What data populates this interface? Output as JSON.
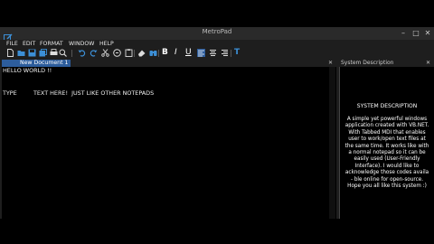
{
  "window": {
    "title": "MetroPad",
    "minimize": "–",
    "maximize": "□",
    "close": "✕"
  },
  "menu": [
    "FILE",
    "EDIT",
    "FORMAT",
    "WINDOW",
    "HELP"
  ],
  "toolbar": {
    "icons": [
      "new-file-icon",
      "open-file-icon",
      "save-icon",
      "save-all-icon",
      "print-icon",
      "print-preview-icon",
      "undo-icon",
      "redo-icon",
      "cut-icon",
      "copy-icon",
      "paste-icon",
      "eraser-icon",
      "find-icon",
      "bold-icon",
      "italic-icon",
      "underline-icon",
      "align-left-icon",
      "align-center-icon",
      "align-right-icon",
      "text-icon"
    ],
    "bold": "B",
    "italic": "I",
    "underline": "U",
    "text": "T"
  },
  "tabs": {
    "document": "New Document 1",
    "close": "✕"
  },
  "editor": {
    "lines": [
      "HELLO WORLD !!",
      "TYPE         TEXT HERE!  JUST LIKE OTHER NOTEPADS"
    ]
  },
  "description_pane": {
    "header": "System Description",
    "close": "✕",
    "title": "SYSTEM DESCRIPTION",
    "body": "A simple yet powerful windows application created with VB.NET. With Tabbed MDI that enables user to work/open text files at the same time. It works like with a normal notepad so it can be easily used (User-Friendly Interface). I would like to acknowledge those codes availa - ble online for open-source. Hope you all like this system :)"
  },
  "colors": {
    "accent": "#2d5d9c",
    "chrome": "#1e1e1e",
    "editor_bg": "#000000",
    "toolbar_icon": "#3c8fd6"
  }
}
